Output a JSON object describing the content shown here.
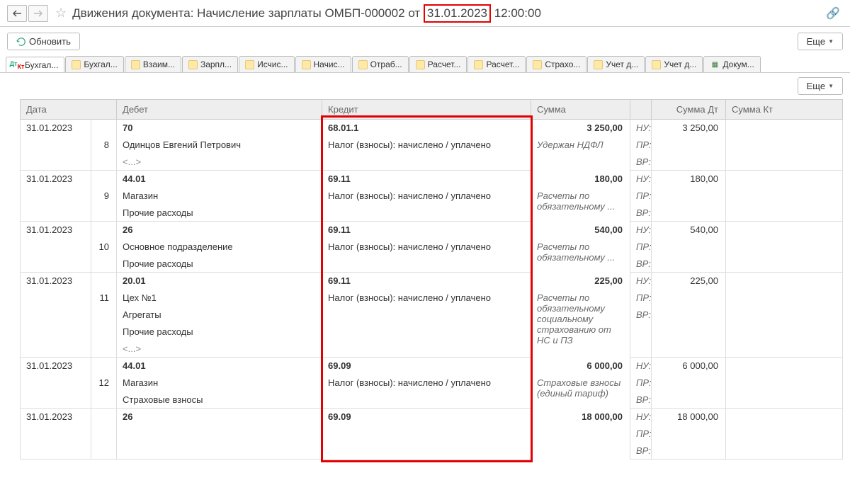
{
  "header": {
    "title_prefix": "Движения документа: Начисление зарплаты ОМБП-000002 от ",
    "date_highlight": "31.01.2023",
    "title_suffix": " 12:00:00"
  },
  "toolbar": {
    "refresh": "Обновить",
    "more": "Еще"
  },
  "tabs": [
    {
      "label": "Бухгал...",
      "type": "dtkt",
      "active": true
    },
    {
      "label": "Бухгал...",
      "type": "reg"
    },
    {
      "label": "Взаим...",
      "type": "reg"
    },
    {
      "label": "Зарпл...",
      "type": "reg"
    },
    {
      "label": "Исчис...",
      "type": "reg"
    },
    {
      "label": "Начис...",
      "type": "reg"
    },
    {
      "label": "Отраб...",
      "type": "reg"
    },
    {
      "label": "Расчет...",
      "type": "reg"
    },
    {
      "label": "Расчет...",
      "type": "reg"
    },
    {
      "label": "Страхо...",
      "type": "reg"
    },
    {
      "label": "Учет д...",
      "type": "reg"
    },
    {
      "label": "Учет д...",
      "type": "reg"
    },
    {
      "label": "Докум...",
      "type": "grid"
    }
  ],
  "columns": {
    "date": "Дата",
    "debit": "Дебет",
    "kredit": "Кредит",
    "sum": "Сумма",
    "sum_dt": "Сумма Дт",
    "sum_kt": "Сумма Кт"
  },
  "tags": {
    "nu": "НУ:",
    "pr": "ПР:",
    "vr": "ВР:"
  },
  "rows": [
    {
      "date": "31.01.2023",
      "num": "8",
      "debit_acc": "70",
      "debit_lines": [
        "Одинцов Евгений Петрович",
        "<...>"
      ],
      "kredit_acc": "68.01.1",
      "kredit_lines": [
        "Налог (взносы): начислено / уплачено"
      ],
      "sum": "3 250,00",
      "sum_desc": "Удержан НДФЛ",
      "sum_dt": "3 250,00"
    },
    {
      "date": "31.01.2023",
      "num": "9",
      "debit_acc": "44.01",
      "debit_lines": [
        "Магазин",
        "Прочие расходы"
      ],
      "kredit_acc": "69.11",
      "kredit_lines": [
        "Налог (взносы): начислено / уплачено"
      ],
      "sum": "180,00",
      "sum_desc": "Расчеты по обязательному ...",
      "sum_dt": "180,00"
    },
    {
      "date": "31.01.2023",
      "num": "10",
      "debit_acc": "26",
      "debit_lines": [
        "Основное подразделение",
        "Прочие расходы"
      ],
      "kredit_acc": "69.11",
      "kredit_lines": [
        "Налог (взносы): начислено / уплачено"
      ],
      "sum": "540,00",
      "sum_desc": "Расчеты по обязательному ...",
      "sum_dt": "540,00"
    },
    {
      "date": "31.01.2023",
      "num": "11",
      "debit_acc": "20.01",
      "debit_lines": [
        "Цех №1",
        "Агрегаты",
        "Прочие расходы",
        "<...>"
      ],
      "kredit_acc": "69.11",
      "kredit_lines": [
        "Налог (взносы): начислено / уплачено"
      ],
      "sum": "225,00",
      "sum_desc": "Расчеты по обязательному социальному страхованию от НС и ПЗ",
      "sum_dt": "225,00"
    },
    {
      "date": "31.01.2023",
      "num": "12",
      "debit_acc": "44.01",
      "debit_lines": [
        "Магазин",
        "Страховые взносы"
      ],
      "kredit_acc": "69.09",
      "kredit_lines": [
        "Налог (взносы): начислено / уплачено"
      ],
      "sum": "6 000,00",
      "sum_desc": "Страховые взносы (единый тариф)",
      "sum_dt": "6 000,00"
    },
    {
      "date": "31.01.2023",
      "num": "",
      "debit_acc": "26",
      "debit_lines": [],
      "kredit_acc": "69.09",
      "kredit_lines": [],
      "sum": "18 000,00",
      "sum_desc": "",
      "sum_dt": "18 000,00"
    }
  ]
}
